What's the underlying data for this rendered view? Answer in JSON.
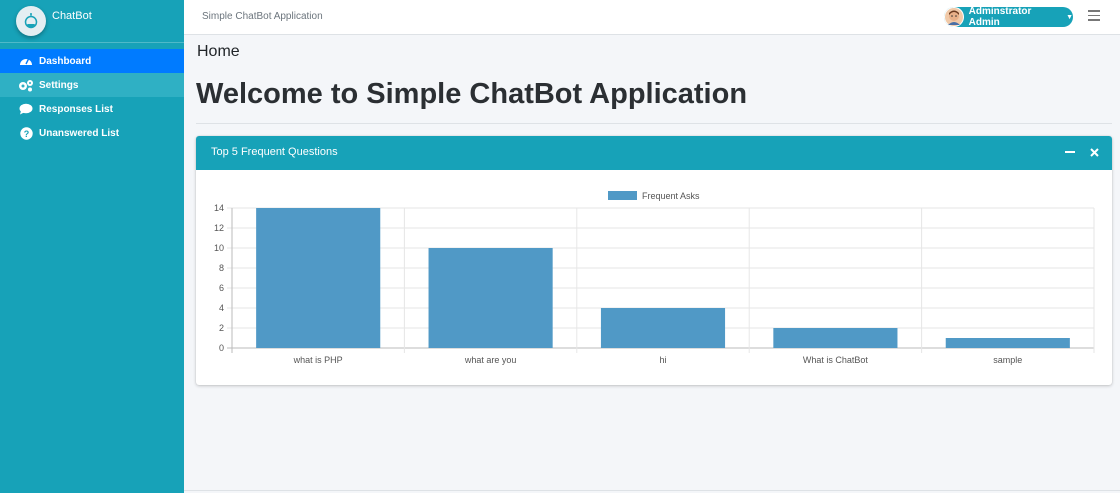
{
  "sidebar": {
    "brand": "ChatBot",
    "items": [
      {
        "label": "Dashboard",
        "icon": "dashboard-icon"
      },
      {
        "label": "Settings",
        "icon": "gears-icon"
      },
      {
        "label": "Responses List",
        "icon": "comment-icon"
      },
      {
        "label": "Unanswered List",
        "icon": "question-icon"
      }
    ]
  },
  "topbar": {
    "title": "Simple ChatBot Application",
    "user": "Adminstrator Admin"
  },
  "content": {
    "breadcrumb": "Home",
    "heading": "Welcome to Simple ChatBot Application"
  },
  "card": {
    "title": "Top 5 Frequent Questions"
  },
  "colors": {
    "sidebar": "#17a2b8",
    "active": "#007bff",
    "bar": "#5099c6"
  },
  "chart_data": {
    "type": "bar",
    "categories": [
      "what is PHP",
      "what are you",
      "hi",
      "What is ChatBot",
      "sample"
    ],
    "series": [
      {
        "name": "Frequent Asks",
        "values": [
          14,
          10,
          4,
          2,
          1
        ]
      }
    ],
    "yticks": [
      0,
      2,
      4,
      6,
      8,
      10,
      12,
      14
    ],
    "ylim": [
      0,
      14
    ],
    "grid": true,
    "legend": "top-center"
  }
}
